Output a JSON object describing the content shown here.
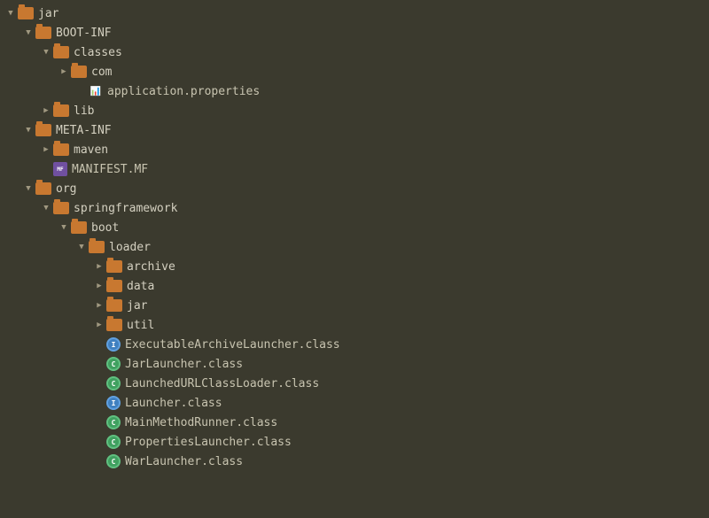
{
  "tree": {
    "items": [
      {
        "id": "jar",
        "label": "jar",
        "type": "folder",
        "state": "expanded",
        "depth": 0
      },
      {
        "id": "boot-inf",
        "label": "BOOT-INF",
        "type": "folder",
        "state": "expanded",
        "depth": 1
      },
      {
        "id": "classes",
        "label": "classes",
        "type": "folder",
        "state": "expanded",
        "depth": 2
      },
      {
        "id": "com",
        "label": "com",
        "type": "folder",
        "state": "collapsed",
        "depth": 3
      },
      {
        "id": "application-properties",
        "label": "application.properties",
        "type": "file-properties",
        "state": "leaf",
        "depth": 4
      },
      {
        "id": "lib",
        "label": "lib",
        "type": "folder",
        "state": "collapsed",
        "depth": 2
      },
      {
        "id": "meta-inf",
        "label": "META-INF",
        "type": "folder",
        "state": "expanded",
        "depth": 1
      },
      {
        "id": "maven",
        "label": "maven",
        "type": "folder",
        "state": "collapsed",
        "depth": 2
      },
      {
        "id": "manifest-mf",
        "label": "MANIFEST.MF",
        "type": "file-manifest",
        "state": "leaf",
        "depth": 2
      },
      {
        "id": "org",
        "label": "org",
        "type": "folder",
        "state": "expanded",
        "depth": 1
      },
      {
        "id": "springframework",
        "label": "springframework",
        "type": "folder",
        "state": "expanded",
        "depth": 2
      },
      {
        "id": "boot",
        "label": "boot",
        "type": "folder",
        "state": "expanded",
        "depth": 3
      },
      {
        "id": "loader",
        "label": "loader",
        "type": "folder",
        "state": "expanded",
        "depth": 4
      },
      {
        "id": "archive",
        "label": "archive",
        "type": "folder",
        "state": "collapsed",
        "depth": 5
      },
      {
        "id": "data",
        "label": "data",
        "type": "folder",
        "state": "collapsed",
        "depth": 5
      },
      {
        "id": "jar2",
        "label": "jar",
        "type": "folder",
        "state": "collapsed",
        "depth": 5
      },
      {
        "id": "util",
        "label": "util",
        "type": "folder",
        "state": "collapsed",
        "depth": 5
      },
      {
        "id": "ExecutableArchiveLauncher",
        "label": "ExecutableArchiveLauncher.class",
        "type": "file-interface",
        "state": "leaf",
        "depth": 5
      },
      {
        "id": "JarLauncher",
        "label": "JarLauncher.class",
        "type": "file-concrete",
        "state": "leaf",
        "depth": 5
      },
      {
        "id": "LaunchedURLClassLoader",
        "label": "LaunchedURLClassLoader.class",
        "type": "file-concrete",
        "state": "leaf",
        "depth": 5
      },
      {
        "id": "Launcher",
        "label": "Launcher.class",
        "type": "file-interface",
        "state": "leaf",
        "depth": 5
      },
      {
        "id": "MainMethodRunner",
        "label": "MainMethodRunner.class",
        "type": "file-concrete",
        "state": "leaf",
        "depth": 5
      },
      {
        "id": "PropertiesLauncher",
        "label": "PropertiesLauncher.class",
        "type": "file-concrete",
        "state": "leaf",
        "depth": 5
      },
      {
        "id": "WarLauncher",
        "label": "WarLauncher.class",
        "type": "file-concrete",
        "state": "leaf",
        "depth": 5
      }
    ]
  }
}
